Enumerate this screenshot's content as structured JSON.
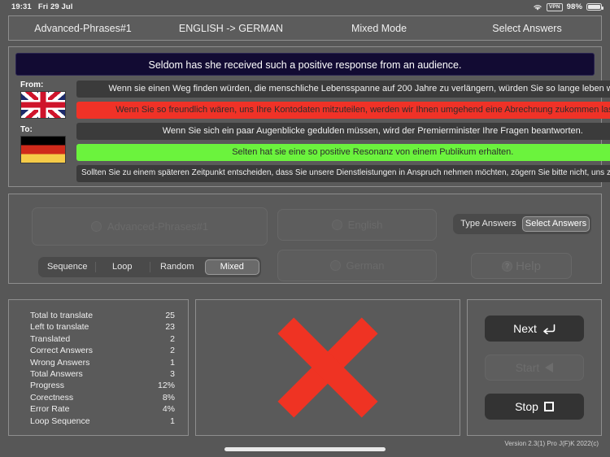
{
  "statusbar": {
    "time": "19:31",
    "date": "Fri 29 Jul",
    "wifi_icon": "wifi-icon",
    "vpn_label": "VPN",
    "battery_percent": "98%"
  },
  "tabbar": {
    "tabs": [
      {
        "label": "Advanced-Phrases#1",
        "name": "tab-lesson"
      },
      {
        "label": "ENGLISH -> GERMAN",
        "name": "tab-direction"
      },
      {
        "label": "Mixed Mode",
        "name": "tab-mode"
      },
      {
        "label": "Select Answers",
        "name": "tab-answer-mode"
      }
    ]
  },
  "phrases": {
    "headline": "Seldom has she received such a positive response from an audience.",
    "from_label": "From:",
    "to_label": "To:",
    "from_flag": "united-kingdom-flag",
    "to_flag": "germany-flag",
    "options": [
      {
        "text": "Wenn sie einen Weg finden würden, die menschliche Lebensspanne auf 200 Jahre zu verlängern, würden Sie so lange leben wollen?",
        "state": "neutral"
      },
      {
        "text": "Wenn Sie so freundlich wären, uns Ihre Kontodaten mitzuteilen, werden wir Ihnen umgehend eine Abrechnung zukommen lassen.",
        "state": "wrong"
      },
      {
        "text": "Wenn Sie sich ein paar Augenblicke gedulden müssen, wird der Premierminister Ihre Fragen beantworten.",
        "state": "neutral"
      },
      {
        "text": "Selten hat sie eine so positive Resonanz von einem Publikum erhalten.",
        "state": "correct"
      },
      {
        "text": "Sollten Sie zu einem späteren Zeitpunkt entscheiden, dass Sie unsere Dienstleistungen in Anspruch nehmen möchten, zögern Sie bitte nicht, uns zu kontaktieren.",
        "state": "neutral"
      }
    ]
  },
  "controls": {
    "lesson_select": "Advanced-Phrases#1",
    "from_language_select": "English",
    "to_language_select": "German",
    "help_label": "Help",
    "help_icon": "question-mark-icon",
    "answer_mode": {
      "options": [
        "Type Answers",
        "Select Answers"
      ],
      "selected": "Select Answers"
    },
    "play_mode": {
      "options": [
        "Sequence",
        "Loop",
        "Random",
        "Mixed"
      ],
      "selected": "Mixed"
    }
  },
  "stats": {
    "rows": [
      {
        "label": "Total to translate",
        "value": "25"
      },
      {
        "label": "Left to translate",
        "value": "23"
      },
      {
        "label": "Translated",
        "value": "2"
      },
      {
        "label": "Correct Answers",
        "value": "2"
      },
      {
        "label": "Wrong Answers",
        "value": "1"
      },
      {
        "label": "Total Answers",
        "value": "3"
      },
      {
        "label": "Progress",
        "value": "12%"
      },
      {
        "label": "Corectness",
        "value": "8%"
      },
      {
        "label": "Error Rate",
        "value": "4%"
      },
      {
        "label": "Loop Sequence",
        "value": "1"
      }
    ]
  },
  "result": {
    "icon": "red-x-mark",
    "color": "#ef3323"
  },
  "actions": {
    "next": {
      "label": "Next",
      "icon": "enter-arrow-icon",
      "enabled": true
    },
    "start": {
      "label": "Start",
      "icon": "play-triangle-icon",
      "enabled": false
    },
    "stop": {
      "label": "Stop",
      "icon": "stop-square-icon",
      "enabled": true
    }
  },
  "footer": {
    "version": "Version 2.3(1) Pro J(F)K 2022(c)"
  }
}
